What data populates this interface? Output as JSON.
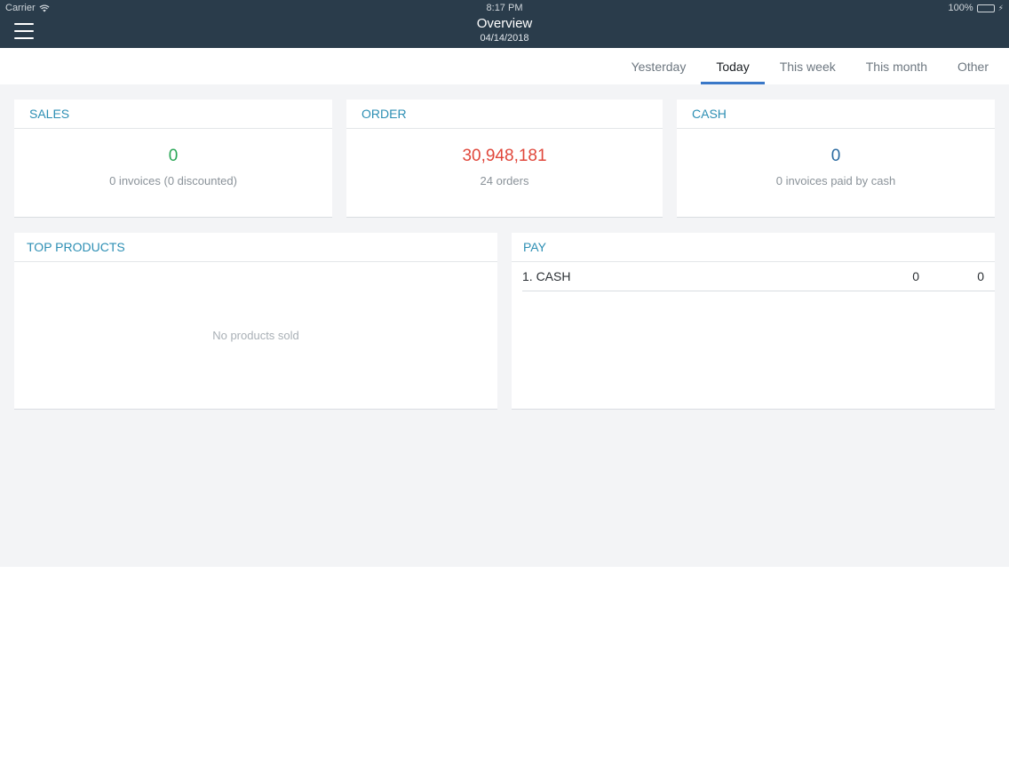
{
  "status_bar": {
    "carrier": "Carrier",
    "time": "8:17 PM",
    "battery": "100%"
  },
  "header": {
    "title": "Overview",
    "date": "04/14/2018"
  },
  "tabs": [
    {
      "label": "Yesterday",
      "active": false
    },
    {
      "label": "Today",
      "active": true
    },
    {
      "label": "This week",
      "active": false
    },
    {
      "label": "This month",
      "active": false
    },
    {
      "label": "Other",
      "active": false
    }
  ],
  "cards": {
    "sales": {
      "title": "SALES",
      "value": "0",
      "detail": "0 invoices (0 discounted)",
      "value_color": "#2aa757"
    },
    "order": {
      "title": "ORDER",
      "value": "30,948,181",
      "detail": "24 orders",
      "value_color": "#e0473b"
    },
    "cash": {
      "title": "CASH",
      "value": "0",
      "detail": "0 invoices paid by cash",
      "value_color": "#2a6aa0"
    }
  },
  "top_products": {
    "title": "TOP PRODUCTS",
    "empty_message": "No products sold"
  },
  "pay": {
    "title": "PAY",
    "rows": [
      {
        "name": "1. CASH",
        "count": "0",
        "amount": "0"
      }
    ]
  },
  "icons": {
    "menu": "hamburger-menu-icon",
    "wifi": "wifi-icon",
    "battery": "battery-icon"
  }
}
